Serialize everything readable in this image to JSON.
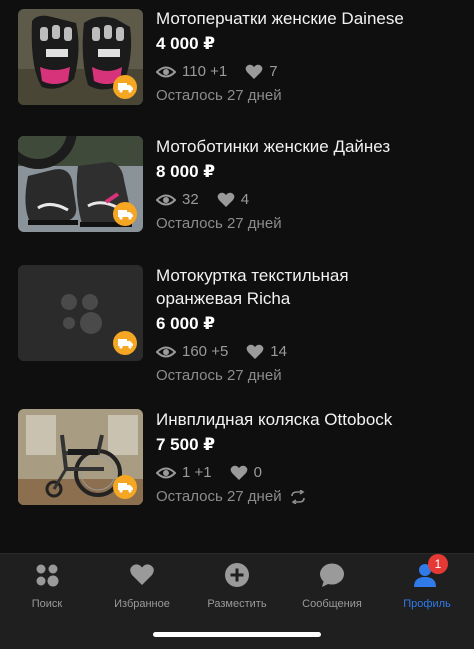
{
  "listings": [
    {
      "title": "Мотоперчатки женские Dainese",
      "price": "4 000 ₽",
      "views": "110 +1",
      "likes": "7",
      "remaining": "Осталось 27 дней",
      "image": "gloves",
      "has_photo": true
    },
    {
      "title": "Мотоботинки женские Дайнез",
      "price": "8 000 ₽",
      "views": "32",
      "likes": "4",
      "remaining": "Осталось 27 дней",
      "image": "boots",
      "has_photo": true
    },
    {
      "title": "Мотокуртка текстильная оранжевая Richa",
      "price": "6 000 ₽",
      "views": "160 +5",
      "likes": "14",
      "remaining": "Осталось 27 дней",
      "image": "placeholder",
      "has_photo": false
    },
    {
      "title": "Инвплидная коляска Ottobock",
      "price": "7 500 ₽",
      "views": "1 +1",
      "likes": "0",
      "remaining": "Осталось 27 дней",
      "image": "wheelchair",
      "has_photo": true,
      "renew_icon": true
    }
  ],
  "tabbar": {
    "tabs": [
      {
        "label": "Поиск",
        "icon": "search-dots-icon"
      },
      {
        "label": "Избранное",
        "icon": "heart-icon"
      },
      {
        "label": "Разместить",
        "icon": "plus-circle-icon"
      },
      {
        "label": "Сообщения",
        "icon": "chat-bubble-icon"
      },
      {
        "label": "Профиль",
        "icon": "profile-icon",
        "active": true,
        "badge": "1"
      }
    ]
  },
  "colors": {
    "background": "#0f0f0f",
    "tabbar": "#1f1f1f",
    "accent": "#2f7bea",
    "delivery_badge": "#f5a623",
    "notification_badge": "#e53935"
  }
}
